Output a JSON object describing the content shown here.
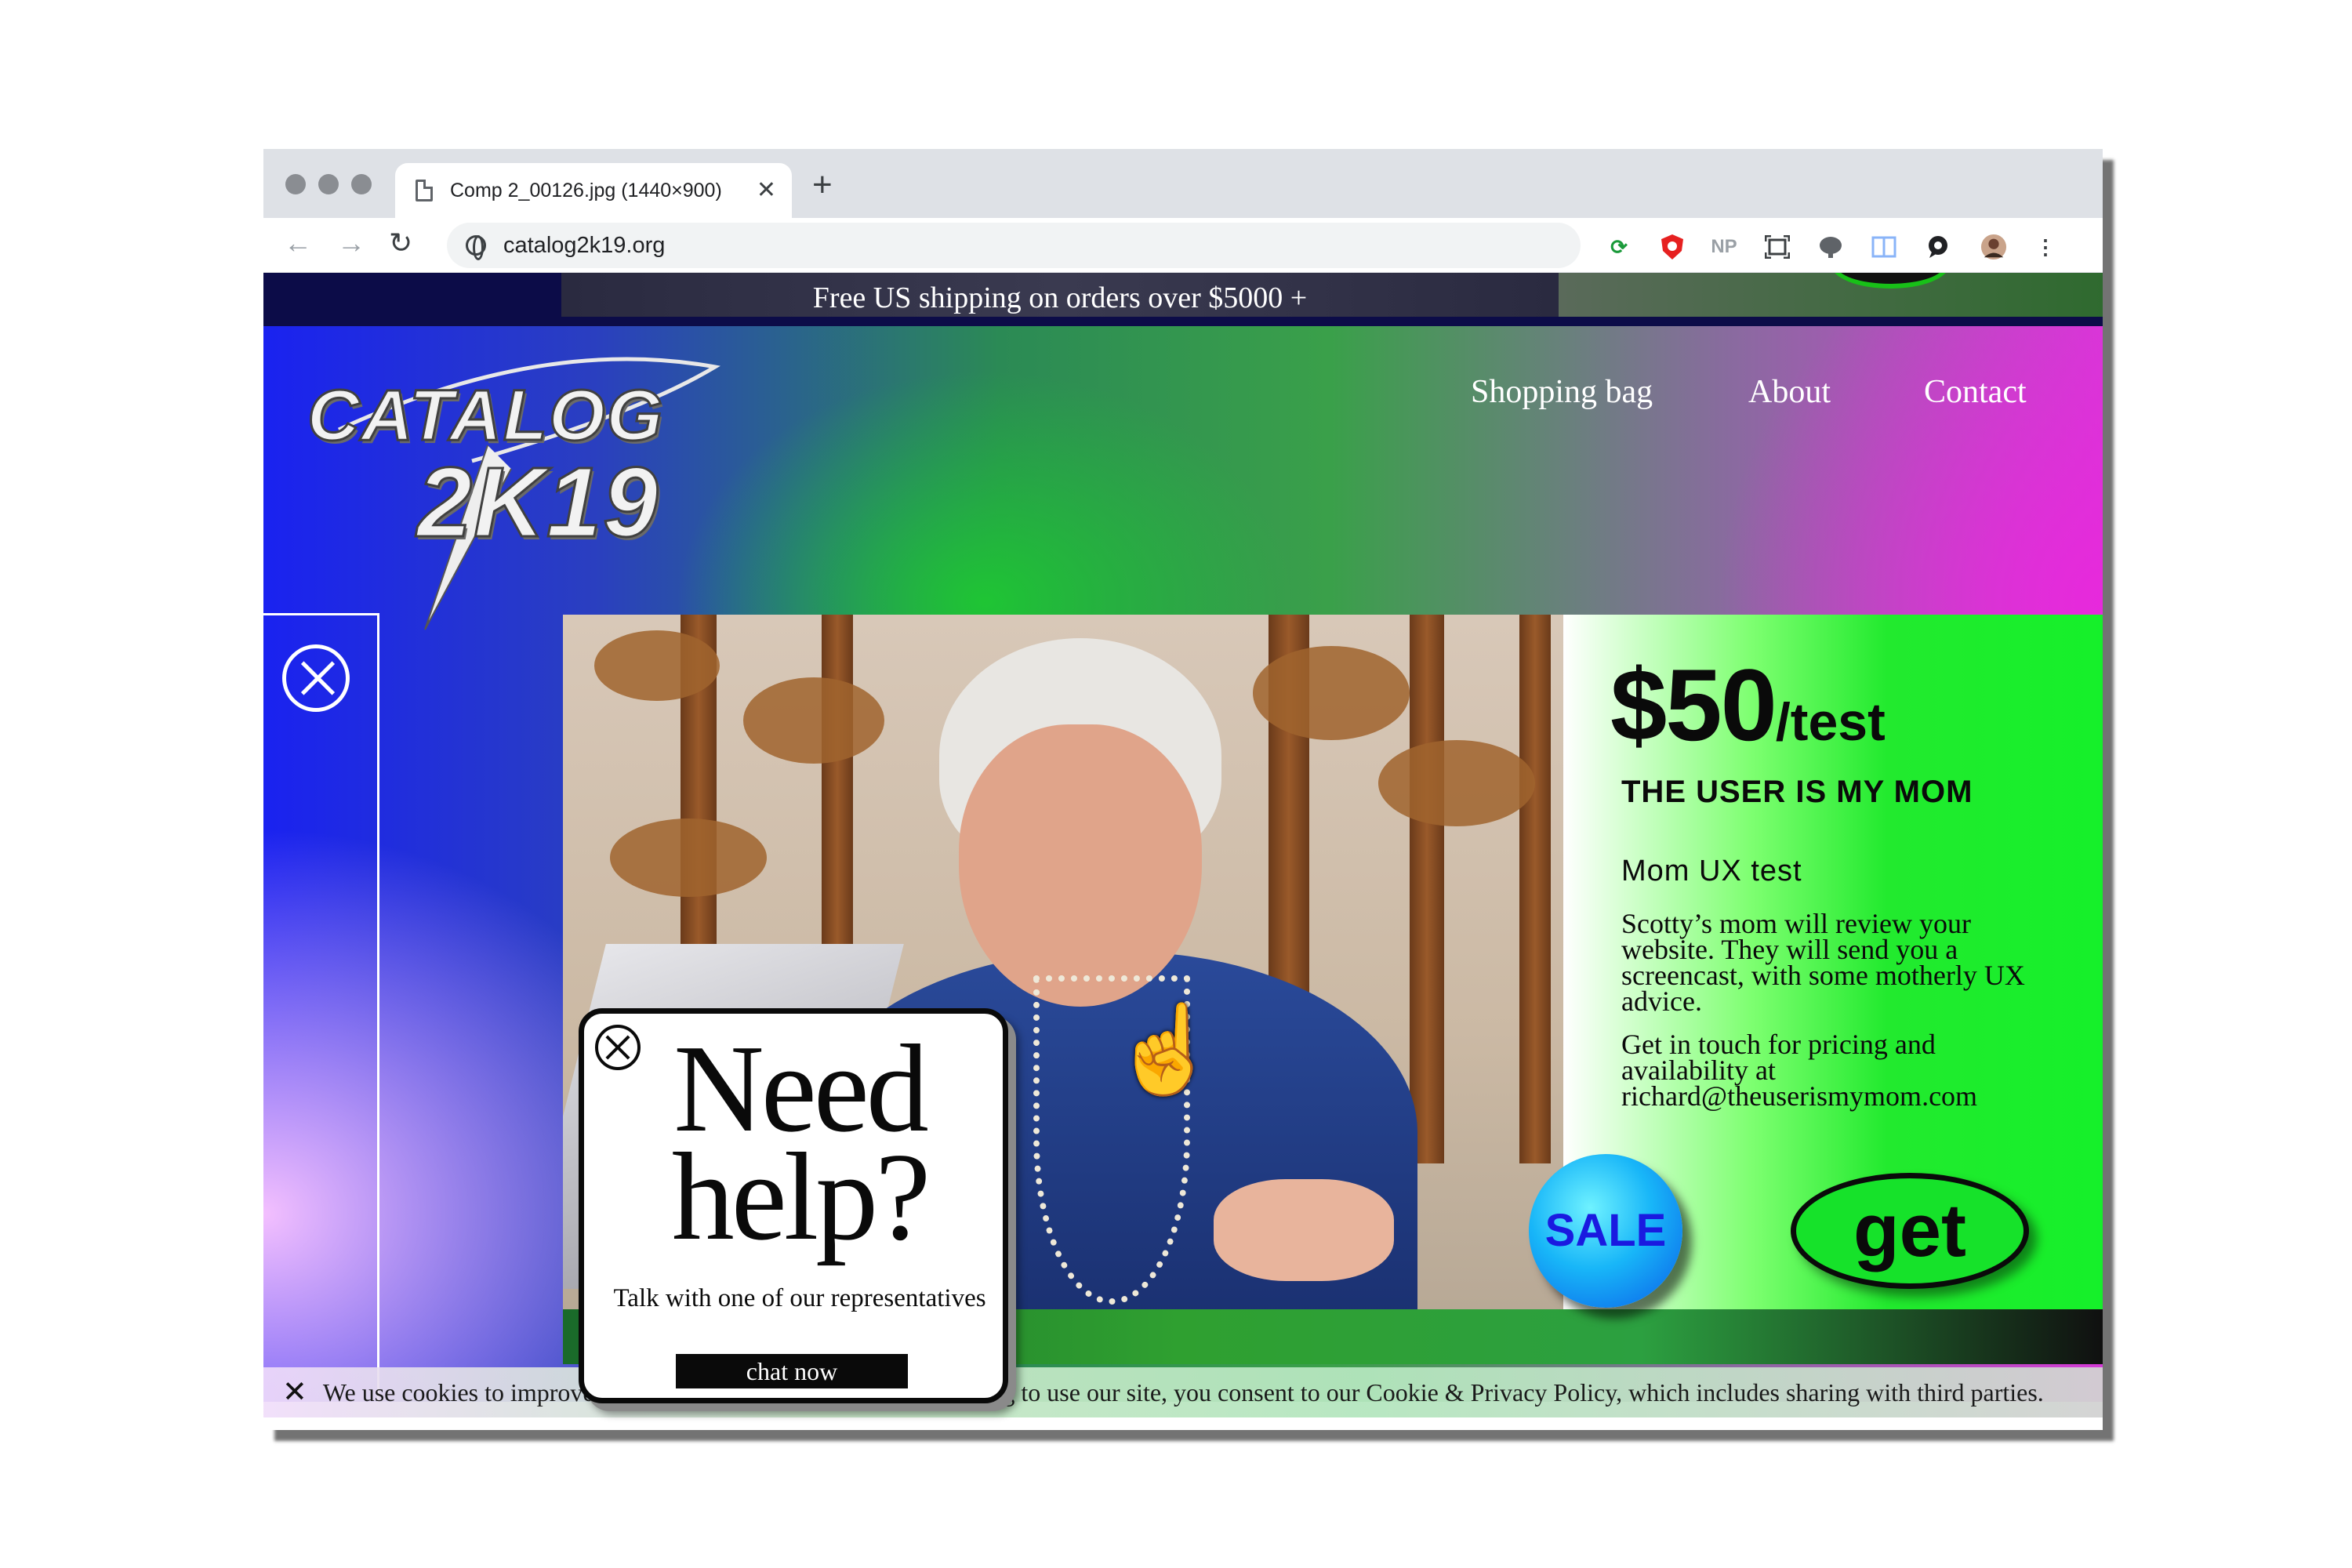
{
  "browser": {
    "tab_title": "Comp 2_00126.jpg (1440×900)",
    "tab_close": "✕",
    "new_tab": "+",
    "url": "catalog2k19.org",
    "extensions": [
      "refresh-ext-icon",
      "shield-ext-icon",
      "np-ext-icon",
      "screenshot-ext-icon",
      "brain-ext-icon",
      "reader-ext-icon",
      "chat-ext-icon",
      "profile-avatar",
      "menu-icon"
    ],
    "np_label": "NP"
  },
  "promo": {
    "text": "Free US shipping on orders over $5000 +"
  },
  "logo": {
    "line1": "CATALOG",
    "line2": "2K19"
  },
  "nav": {
    "bag": "Shopping bag",
    "about": "About",
    "contact": "Contact"
  },
  "offer": {
    "price": "$50",
    "unit": "/test",
    "heading": "THE USER IS MY MOM",
    "subheading": "Mom UX test",
    "body": "Scotty’s  mom will review your website. They will send you a screencast, with some motherly UX advice.",
    "contact": "Get in touch for pricing and availability at richard@theuserismymom.com"
  },
  "buttons": {
    "sale": "SALE",
    "get": "get"
  },
  "help": {
    "title": "Need help?",
    "subtitle": "Talk with one of our representatives",
    "chat_label": "chat now"
  },
  "cookie": {
    "close": "✕",
    "text": "We use cookies to improve your shopping experience. By continuing to use our site, you consent to our Cookie & Privacy Policy, which includes sharing with third parties."
  },
  "colors": {
    "accent_green": "#16e22a",
    "sale_blue": "#18b6f8",
    "hero_blue": "#1a22f0",
    "hero_magenta": "#d43ad6"
  }
}
